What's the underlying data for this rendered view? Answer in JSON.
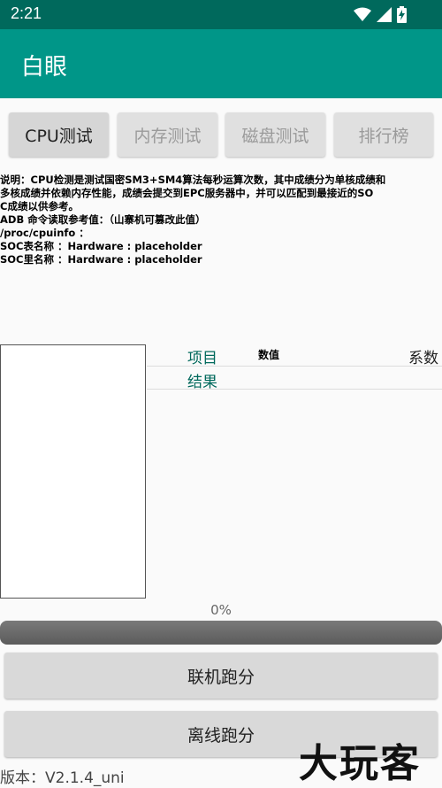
{
  "status_bar": {
    "time": "2:21",
    "icons": [
      "wifi-icon",
      "signal-icon",
      "battery-charging-icon"
    ]
  },
  "app_bar": {
    "title": "白眼"
  },
  "tabs": [
    {
      "label": "CPU测试",
      "active": true
    },
    {
      "label": "内存测试",
      "active": false
    },
    {
      "label": "磁盘测试",
      "active": false
    },
    {
      "label": "排行榜",
      "active": false
    }
  ],
  "description": {
    "lines": [
      "说明：CPU检测是测试国密SM3+SM4算法每秒运算次数，其中成绩分为单核成绩和",
      "多核成绩并依赖内存性能，成绩会提交到EPC服务器中，并可以匹配到最接近的SO",
      "C成绩以供参考。",
      "ADB 命令读取参考值：（山寨机可篡改此值）",
      "/proc/cpuinfo ：",
      "SOC表名称 ：Hardware : placeholder",
      "SOC里名称 ：Hardware : placeholder"
    ]
  },
  "results_table": {
    "col_item": "项目",
    "col_value": "数值",
    "col_coef": "系数",
    "row_result": "结果"
  },
  "progress": {
    "label": "0%",
    "value": 0
  },
  "buttons": {
    "online": "联机跑分",
    "offline": "离线跑分"
  },
  "version": "版本：V2.1.4_uni",
  "watermark": "大玩客",
  "colors": {
    "status_bar": "#00695c",
    "app_bar": "#009688",
    "accent_text": "#00695c"
  }
}
